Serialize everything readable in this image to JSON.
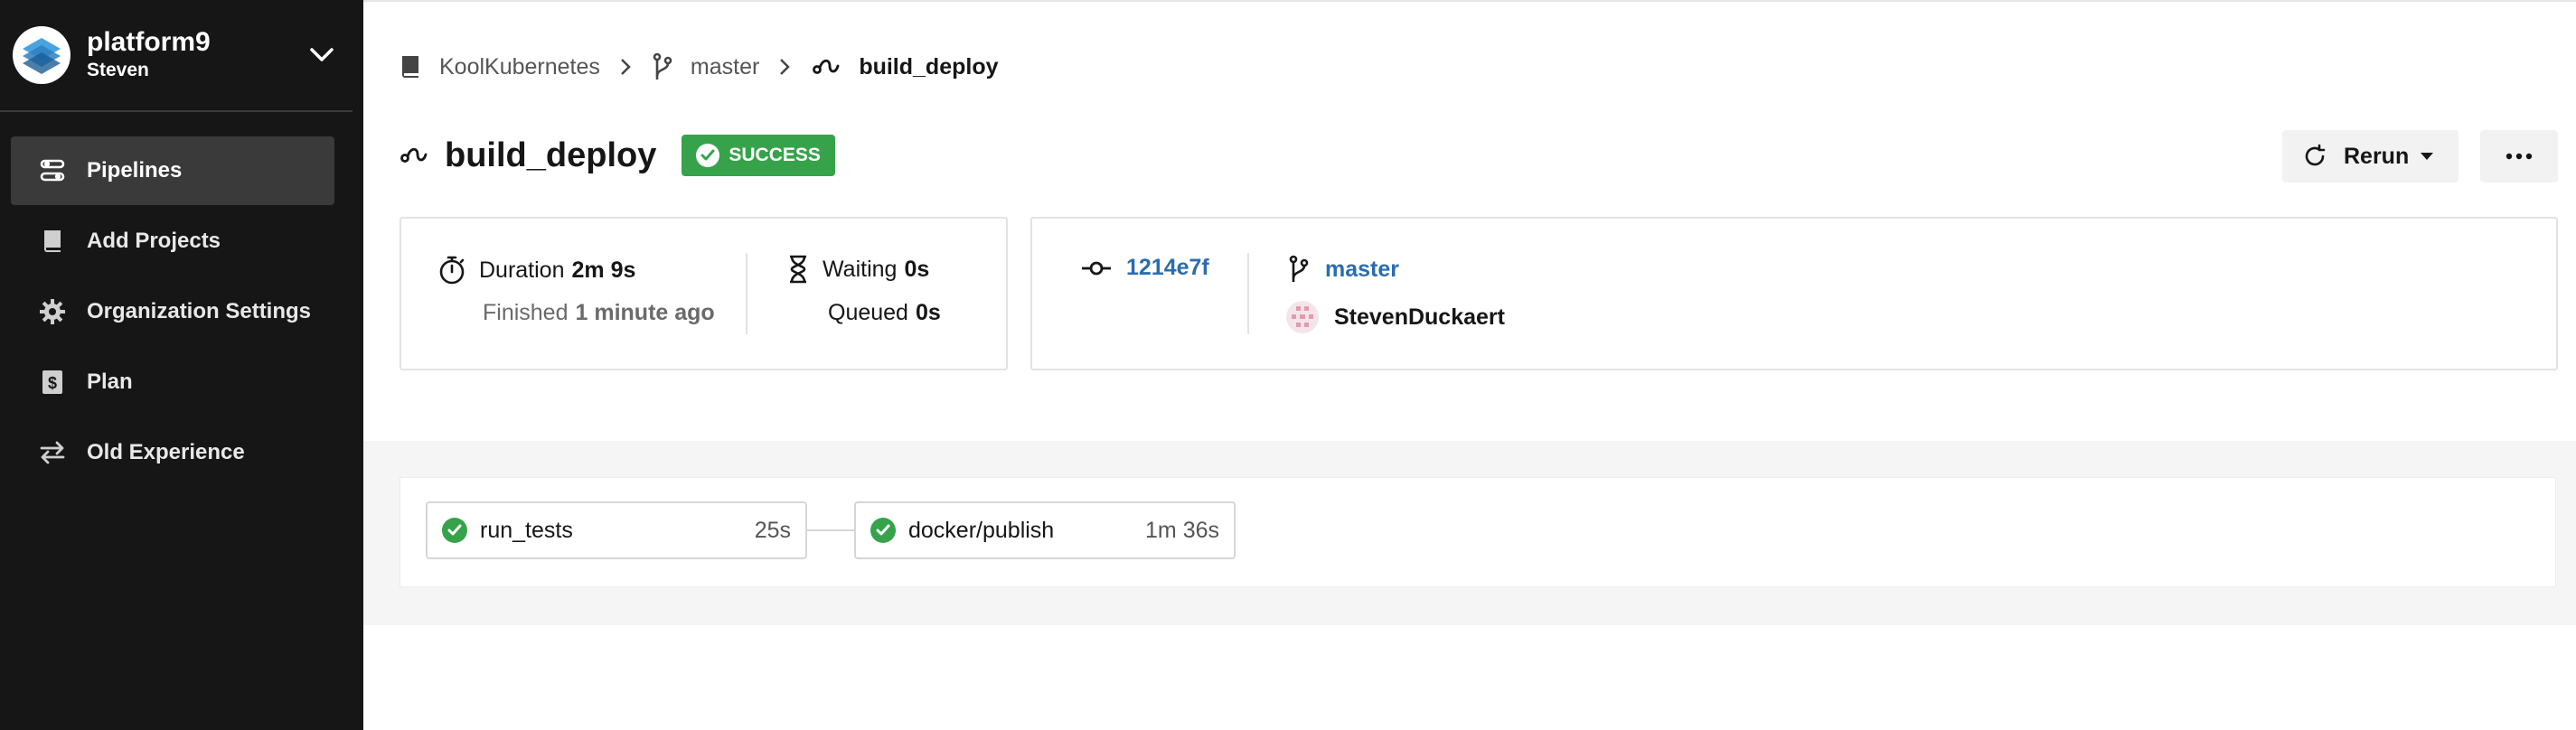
{
  "sidebar": {
    "org_name": "platform9",
    "org_user": "Steven",
    "items": [
      {
        "label": "Pipelines",
        "icon": "pipelines-icon",
        "active": true
      },
      {
        "label": "Add Projects",
        "icon": "book-icon",
        "active": false
      },
      {
        "label": "Organization Settings",
        "icon": "gear-icon",
        "active": false
      },
      {
        "label": "Plan",
        "icon": "dollar-icon",
        "active": false
      },
      {
        "label": "Old Experience",
        "icon": "switch-icon",
        "active": false
      }
    ]
  },
  "breadcrumb": {
    "project": "KoolKubernetes",
    "branch": "master",
    "workflow": "build_deploy"
  },
  "header": {
    "title": "build_deploy",
    "status": "SUCCESS",
    "status_color": "#36a34b",
    "rerun_label": "Rerun",
    "more_label": "···"
  },
  "summary": {
    "duration_label": "Duration",
    "duration_value": "2m 9s",
    "finished_label": "Finished",
    "finished_value": "1 minute ago",
    "waiting_label": "Waiting",
    "waiting_value": "0s",
    "queued_label": "Queued",
    "queued_value": "0s"
  },
  "commit": {
    "hash": "1214e7f",
    "branch": "master",
    "author": "StevenDuckaert"
  },
  "jobs": [
    {
      "name": "run_tests",
      "duration": "25s",
      "status": "success"
    },
    {
      "name": "docker/publish",
      "duration": "1m 36s",
      "status": "success"
    }
  ],
  "colors": {
    "sidebar_bg": "#161616",
    "success": "#36a34b",
    "link": "#2b6cb0"
  }
}
